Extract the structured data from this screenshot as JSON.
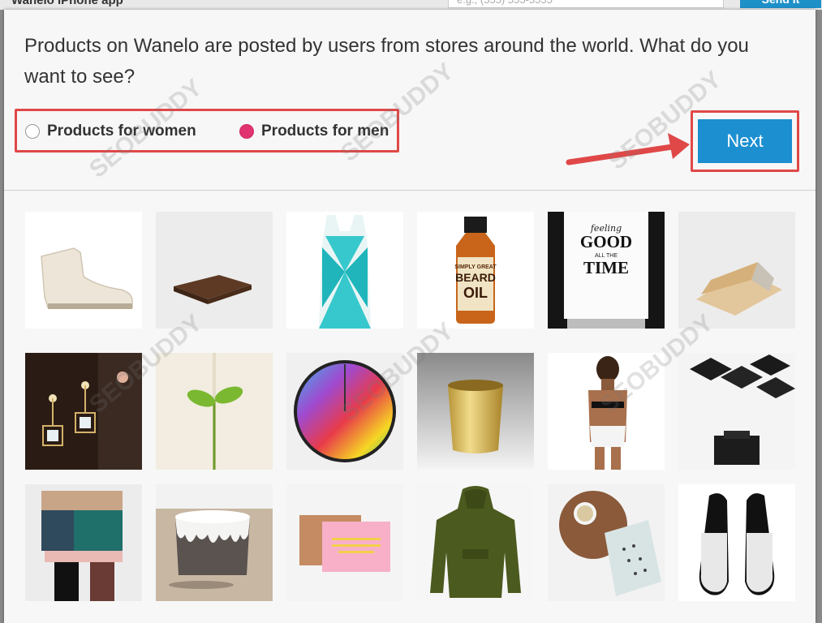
{
  "background": {
    "partial_text": "Wanelo iPhone app",
    "phone_placeholder": "e.g., (555) 555-5555",
    "send_label": "Send it"
  },
  "modal": {
    "intro": "Products on Wanelo are posted by users from stores around the world. What do you want to see?",
    "options": [
      {
        "label": "Products for women",
        "selected": false
      },
      {
        "label": "Products for men",
        "selected": true
      }
    ],
    "next_label": "Next"
  },
  "products": [
    {
      "name": "white-boot"
    },
    {
      "name": "wood-tray"
    },
    {
      "name": "turquoise-dress"
    },
    {
      "name": "beard-oil-bottle",
      "text": [
        "SIMPLY GREAT",
        "BEARD",
        "OIL"
      ]
    },
    {
      "name": "good-time-poster",
      "text": [
        "feeling",
        "GOOD",
        "ALL THE",
        "TIME"
      ]
    },
    {
      "name": "wooden-box"
    },
    {
      "name": "cube-earrings"
    },
    {
      "name": "sprout-book"
    },
    {
      "name": "color-wheel-clock"
    },
    {
      "name": "gold-cup"
    },
    {
      "name": "model-lingerie"
    },
    {
      "name": "marble-coasters"
    },
    {
      "name": "woven-wall-hanging"
    },
    {
      "name": "drip-glaze-mug"
    },
    {
      "name": "greeting-card"
    },
    {
      "name": "green-hoodie"
    },
    {
      "name": "tea-set"
    },
    {
      "name": "black-flats"
    }
  ],
  "colors": {
    "accent": "#1c8fd0",
    "radio_selected": "#e0336f",
    "highlight": "#e04848"
  }
}
